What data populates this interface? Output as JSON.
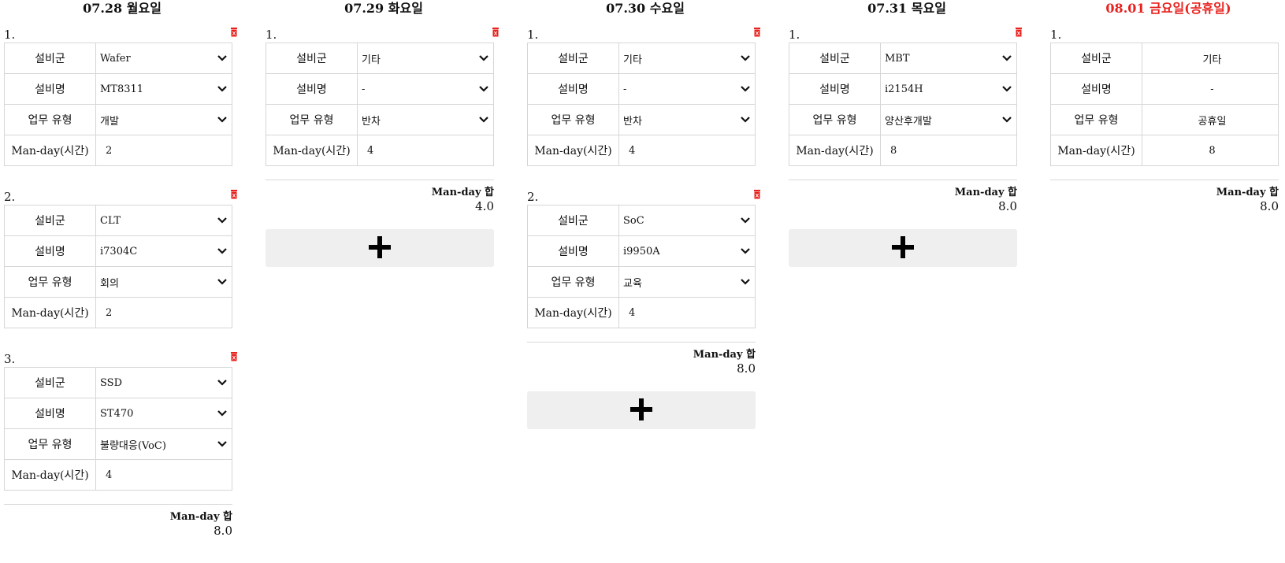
{
  "days": [
    {
      "title": "07.28 월요일",
      "entries": [
        {
          "num": "1.",
          "group": "Wafer",
          "name": "MT8311",
          "work_type": "개발",
          "hours": "2"
        },
        {
          "num": "2.",
          "group": "CLT",
          "name": "i7304C",
          "work_type": "회의",
          "hours": "2"
        },
        {
          "num": "3.",
          "group": "SSD",
          "name": "ST470",
          "work_type": "불량대응(VoC)",
          "hours": "4"
        }
      ],
      "summary_label": "Man-day 합",
      "summary_value": "8.0"
    },
    {
      "title": "07.29 화요일",
      "entries": [
        {
          "num": "1.",
          "group": "기타",
          "name": "-",
          "work_type": "반차",
          "hours": "4"
        }
      ],
      "summary_label": "Man-day 합",
      "summary_value": "4.0"
    },
    {
      "title": "07.30 수요일",
      "entries": [
        {
          "num": "1.",
          "group": "기타",
          "name": "-",
          "work_type": "반차",
          "hours": "4"
        },
        {
          "num": "2.",
          "group": "SoC",
          "name": "i9950A",
          "work_type": "교육",
          "hours": "4"
        }
      ],
      "summary_label": "Man-day 합",
      "summary_value": "8.0"
    },
    {
      "title": "07.31 목요일",
      "entries": [
        {
          "num": "1.",
          "group": "MBT",
          "name": "i2154H",
          "work_type": "양산후개발",
          "hours": "8"
        }
      ],
      "summary_label": "Man-day 합",
      "summary_value": "8.0"
    },
    {
      "title": "08.01 금요일(공휴일)",
      "entries": [
        {
          "num": "1.",
          "group": "기타",
          "name": "-",
          "work_type": "공휴일",
          "hours": "8"
        }
      ],
      "summary_label": "Man-day 합",
      "summary_value": "8.0"
    }
  ],
  "labels": {
    "group": "설비군",
    "name": "설비명",
    "work_type": "업무 유형",
    "hours": "Man-day(시간)"
  },
  "colors": {
    "holiday_title": "#e8211d",
    "trash": "#e8211d",
    "add_button_bg": "#efefef",
    "border": "#d6d6d6"
  },
  "icons": {
    "delete": "trash-icon",
    "dropdown": "chevron-down-icon",
    "add": "plus-icon"
  }
}
